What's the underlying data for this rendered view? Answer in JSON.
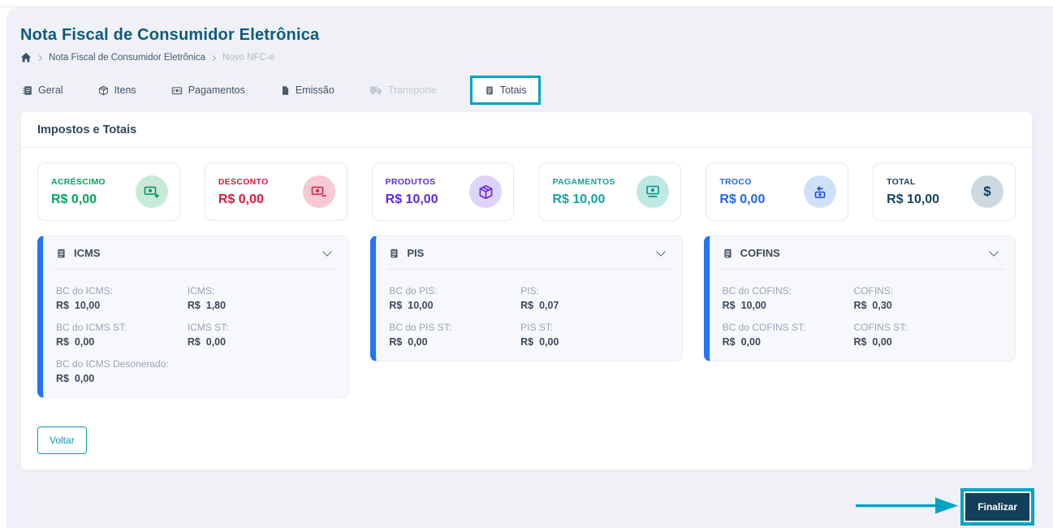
{
  "header": {
    "title": "Nota Fiscal de Consumidor Eletrônica",
    "breadcrumb": {
      "items": [
        {
          "label": "Nota Fiscal de Consumidor Eletrônica"
        },
        {
          "label": "Novo NFC-e"
        }
      ]
    }
  },
  "tabs": [
    {
      "label": "Geral",
      "icon": "journal-icon",
      "state": "default"
    },
    {
      "label": "Itens",
      "icon": "package-icon",
      "state": "default"
    },
    {
      "label": "Pagamentos",
      "icon": "cash-icon",
      "state": "default"
    },
    {
      "label": "Emissão",
      "icon": "file-icon",
      "state": "default"
    },
    {
      "label": "Transporte",
      "icon": "truck-icon",
      "state": "disabled"
    },
    {
      "label": "Totais",
      "icon": "calculator-icon",
      "state": "active",
      "highlighted": true
    }
  ],
  "panel": {
    "title": "Impostos e Totais",
    "summary_cards": [
      {
        "label": "ACRÉSCIMO",
        "value": "R$ 0,00",
        "icon": "cash-plus-icon",
        "accent": "#00a65d"
      },
      {
        "label": "DESCONTO",
        "value": "R$ 0,00",
        "icon": "cash-minus-icon",
        "accent": "#e0163c"
      },
      {
        "label": "PRODUTOS",
        "value": "R$ 10,00",
        "icon": "package-icon",
        "accent": "#5c2be2"
      },
      {
        "label": "PAGAMENTOS",
        "value": "R$ 10,00",
        "icon": "cash-stack-icon",
        "accent": "#16a3a1"
      },
      {
        "label": "TROCO",
        "value": "R$ 0,00",
        "icon": "cash-refund-icon",
        "accent": "#2166f0"
      },
      {
        "label": "TOTAL",
        "value": "R$ 10,00",
        "icon": "dollar-icon",
        "accent": "#17455f"
      }
    ],
    "tax_groups": [
      {
        "title": "ICMS",
        "icon": "calculator-icon",
        "fields": [
          {
            "label": "BC do ICMS:",
            "value": "R$  10,00"
          },
          {
            "label": "ICMS:",
            "value": "R$  1,80"
          },
          {
            "label": "BC do ICMS ST:",
            "value": "R$  0,00"
          },
          {
            "label": "ICMS ST:",
            "value": "R$  0,00"
          },
          {
            "label": "BC do ICMS Desonerado:",
            "value": "R$  0,00"
          }
        ]
      },
      {
        "title": "PIS",
        "icon": "calculator-icon",
        "fields": [
          {
            "label": "BC do PIS:",
            "value": "R$  10,00"
          },
          {
            "label": "PIS:",
            "value": "R$  0,07"
          },
          {
            "label": "BC do PIS ST:",
            "value": "R$  0,00"
          },
          {
            "label": "PIS ST:",
            "value": "R$  0,00"
          }
        ]
      },
      {
        "title": "COFINS",
        "icon": "calculator-icon",
        "fields": [
          {
            "label": "BC do COFINS:",
            "value": "R$  10,00"
          },
          {
            "label": "COFINS:",
            "value": "R$  0,30"
          },
          {
            "label": "BC do COFINS ST:",
            "value": "R$  0,00"
          },
          {
            "label": "COFINS ST:",
            "value": "R$  0,00"
          }
        ]
      }
    ],
    "back_button": "Voltar"
  },
  "footer": {
    "finish_button": "Finalizar"
  },
  "colors": {
    "highlight_annotation": "#00a3c4",
    "title": "#0c5b7d",
    "page_background": "#eff1f6",
    "tax_panel_accent": "#2673f5",
    "finish_button_bg": "#133f5b",
    "back_button_border": "#0d98ab"
  }
}
